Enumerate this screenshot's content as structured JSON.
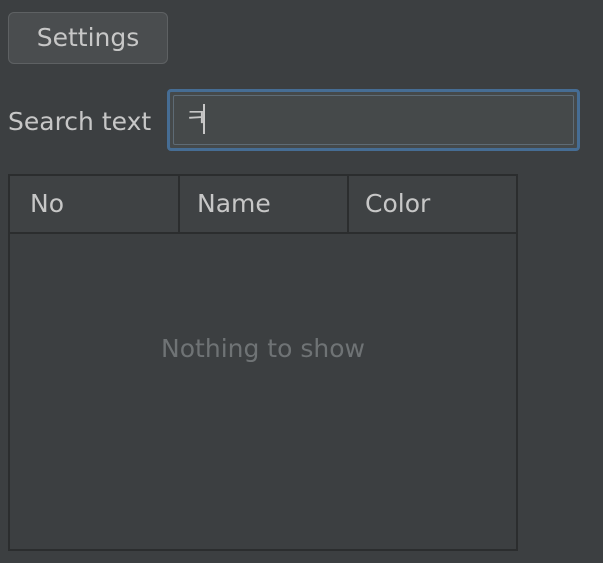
{
  "toolbar": {
    "settings_label": "Settings"
  },
  "search": {
    "label": "Search text",
    "value": "ㅋ"
  },
  "table": {
    "columns": [
      "No",
      "Name",
      "Color"
    ],
    "empty_text": "Nothing to show"
  }
}
